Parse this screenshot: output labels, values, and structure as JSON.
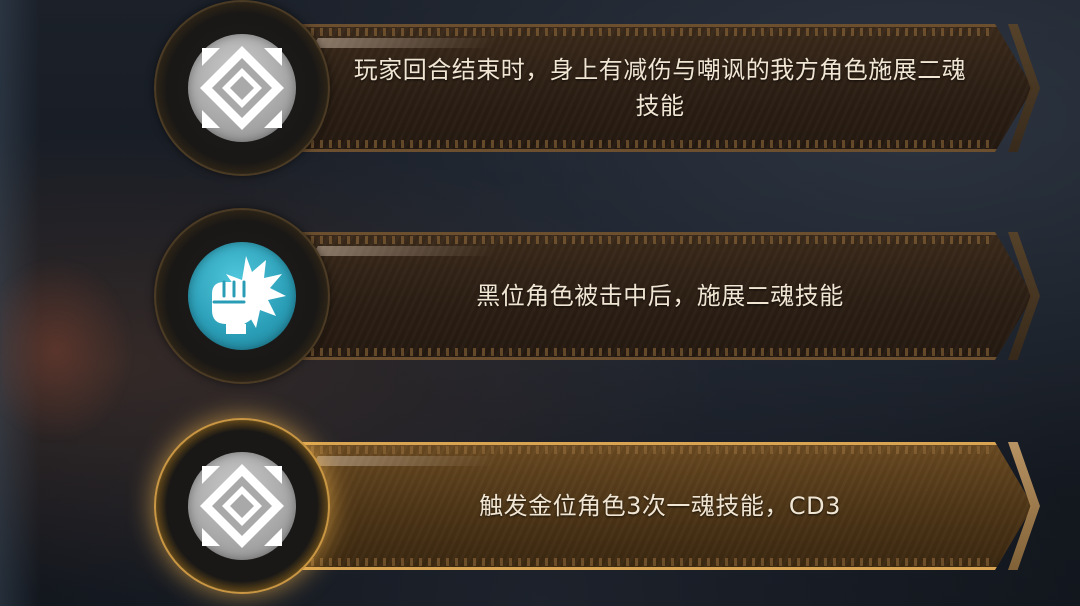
{
  "rows": [
    {
      "icon": "diamond-emblem-icon",
      "icon_color": "#a9a9a9",
      "text": "玩家回合结束时，身上有减伤与嘲讽的我方角色施展二魂技能",
      "highlighted": false
    },
    {
      "icon": "fist-impact-icon",
      "icon_color": "#2a9db6",
      "text": "黑位角色被击中后，施展二魂技能",
      "highlighted": false
    },
    {
      "icon": "diamond-emblem-icon",
      "icon_color": "#a9a9a9",
      "text": "触发金位角色3次一魂技能，CD3",
      "highlighted": true
    }
  ],
  "colors": {
    "banner": "#2c1f14",
    "banner_highlight": "#6a4a22",
    "glow": "#f2c26a",
    "text": "#f1e6d4"
  }
}
